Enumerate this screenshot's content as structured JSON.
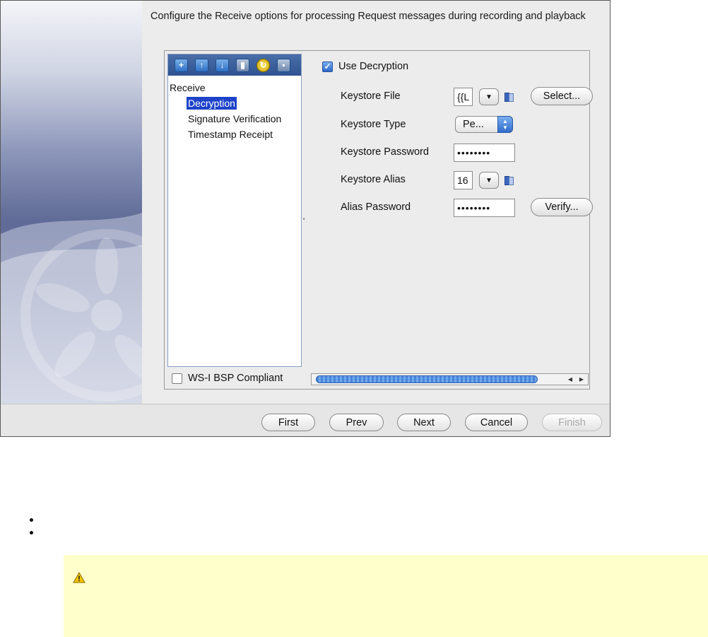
{
  "instruction": "Configure the Receive options for processing Request messages during recording and playback",
  "toolbar": {
    "icons": [
      "add-icon",
      "move-up-icon",
      "move-down-icon",
      "delete-icon",
      "refresh-icon",
      "save-icon"
    ],
    "colors": {
      "toolbar_bg": "#2f5390",
      "selection": "#1d43c9"
    }
  },
  "tree": {
    "root": "Receive",
    "children": [
      {
        "label": "Decryption",
        "selected": true
      },
      {
        "label": "Signature Verification",
        "selected": false
      },
      {
        "label": "Timestamp Receipt",
        "selected": false
      }
    ]
  },
  "bsp_compliant": {
    "label": "WS-I BSP Compliant",
    "checked": false
  },
  "use_decryption": {
    "label": "Use Decryption",
    "checked": true
  },
  "fields": {
    "keystore_file": {
      "label": "Keystore File",
      "value": "{{L"
    },
    "keystore_type": {
      "label": "Keystore Type",
      "value": "Pe..."
    },
    "keystore_password": {
      "label": "Keystore Password",
      "value": "••••••••"
    },
    "keystore_alias": {
      "label": "Keystore Alias",
      "value": "16"
    },
    "alias_password": {
      "label": "Alias Password",
      "value": "••••••••"
    }
  },
  "buttons": {
    "select": "Select...",
    "verify": "Verify...",
    "first": "First",
    "prev": "Prev",
    "next": "Next",
    "cancel": "Cancel",
    "finish": "Finish"
  }
}
